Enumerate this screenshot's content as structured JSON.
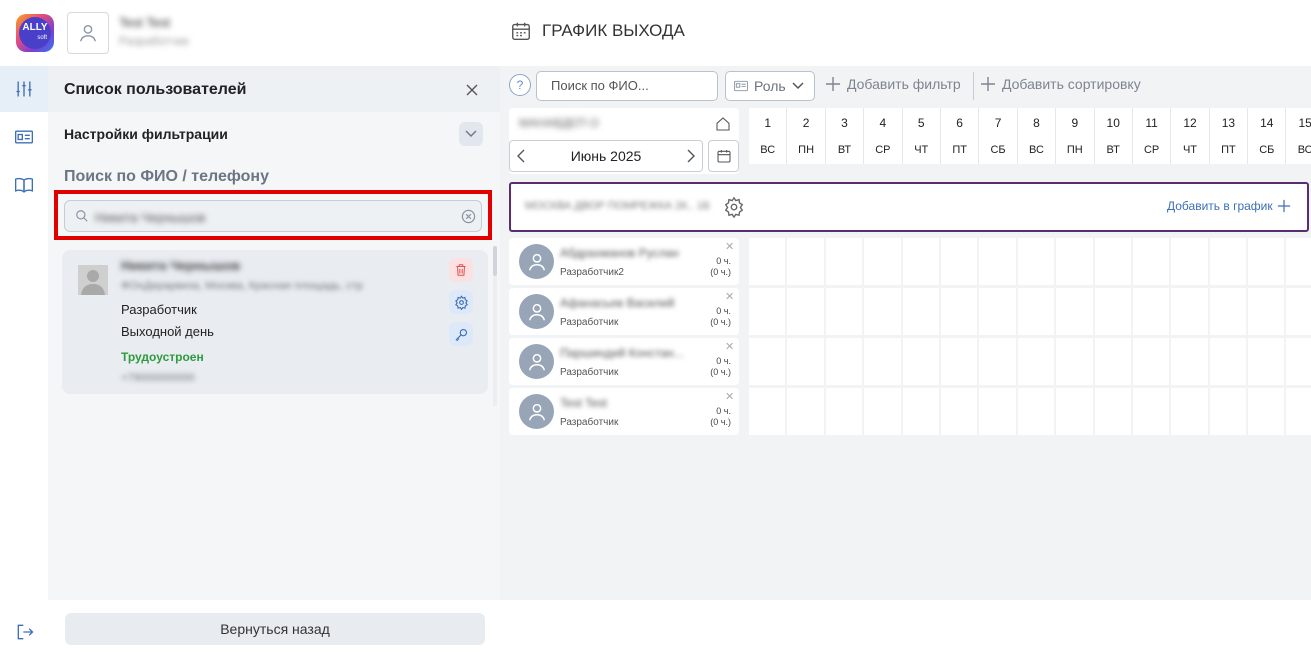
{
  "header": {
    "user_name": "Test Test",
    "user_role": "Разработчик",
    "page_title": "ГРАФИК ВЫХОДА",
    "logo_text": "ALLY",
    "logo_sub": "soft"
  },
  "rail": {
    "items": [
      "filters-icon",
      "id-card-icon",
      "book-icon"
    ],
    "logout": "logout-icon"
  },
  "panel": {
    "title": "Список пользователей",
    "filter_settings": "Настройки фильтрации",
    "search_label": "Поиск по ФИО / телефону",
    "search_value": "Никита Чернышов",
    "user_card": {
      "name": "Никита Чернышов",
      "org": "ФОнДерарвиза, Москва, Красная площадь, стр",
      "role": "Разработчик",
      "day": "Выходной день",
      "status": "Трудоустроен",
      "phone": "+79000000000"
    },
    "back_button": "Вернуться назад"
  },
  "toolbar": {
    "help": "?",
    "search_placeholder": "Поиск по ФИО...",
    "role_label": "Роль",
    "add_filter": "Добавить фильтр",
    "add_sort": "Добавить сортировку"
  },
  "calendar": {
    "org_name": "МАНАВДЕП О",
    "month": "Июнь 2025",
    "days": [
      {
        "num": "1",
        "name": "ВС"
      },
      {
        "num": "2",
        "name": "ПН"
      },
      {
        "num": "3",
        "name": "ВТ"
      },
      {
        "num": "4",
        "name": "СР"
      },
      {
        "num": "5",
        "name": "ЧТ"
      },
      {
        "num": "6",
        "name": "ПТ"
      },
      {
        "num": "7",
        "name": "СБ"
      },
      {
        "num": "8",
        "name": "ВС"
      },
      {
        "num": "9",
        "name": "ПН"
      },
      {
        "num": "10",
        "name": "ВТ"
      },
      {
        "num": "11",
        "name": "СР"
      },
      {
        "num": "12",
        "name": "ЧТ"
      },
      {
        "num": "13",
        "name": "ПТ"
      },
      {
        "num": "14",
        "name": "СБ"
      },
      {
        "num": "15",
        "name": "ВС"
      }
    ]
  },
  "group": {
    "name": "МОСКВА ДВОР ПОМРЕЖКА 2К.. 1Б",
    "add_label": "Добавить в график"
  },
  "employees": [
    {
      "name": "Абдрахманов Руслан",
      "role": "Разработчик2",
      "hours": "0 ч.",
      "hours_total": "(0 ч.)"
    },
    {
      "name": "Афанасьев Василий",
      "role": "Разработчик",
      "hours": "0 ч.",
      "hours_total": "(0 ч.)"
    },
    {
      "name": "Паршиндий Констан...",
      "role": "Разработчик",
      "hours": "0 ч.",
      "hours_total": "(0 ч.)"
    },
    {
      "name": "Test Test",
      "role": "Разработчик",
      "hours": "0 ч.",
      "hours_total": "(0 ч.)"
    }
  ],
  "colors": {
    "highlight": "#e00000",
    "group_border": "#5a2e6e",
    "status_green": "#2e9b3e",
    "accent_blue": "#3d6fb6"
  }
}
